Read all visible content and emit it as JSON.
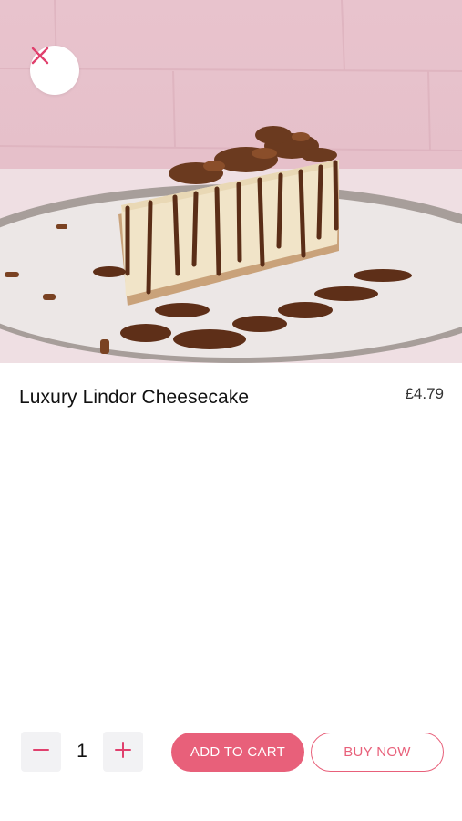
{
  "product": {
    "name": "Luxury Lindor Cheesecake",
    "price": "£4.79",
    "image_subject": "cheesecake-slice-photo"
  },
  "header": {
    "close_icon": "close-icon"
  },
  "quantity": {
    "value": "1",
    "decrement_icon": "minus-icon",
    "increment_icon": "plus-icon"
  },
  "actions": {
    "add_to_cart_label": "ADD TO CART",
    "buy_now_label": "BUY NOW"
  },
  "colors": {
    "accent": "#e8607a",
    "background": "#ffffff",
    "stepper_bg": "#f2f2f4"
  }
}
